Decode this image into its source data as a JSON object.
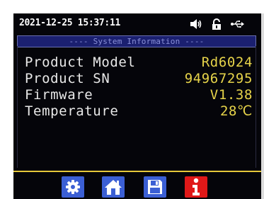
{
  "status_bar": {
    "datetime": "2021-12-25 15:37:11",
    "icons": [
      "speaker-icon",
      "unlock-icon",
      "usb-icon"
    ]
  },
  "section": {
    "title": "---- System Information ----"
  },
  "info_rows": [
    {
      "label": "Product Model",
      "value": "Rd6024"
    },
    {
      "label": "Product SN",
      "value": "94967295"
    },
    {
      "label": "Firmware",
      "value": "V1.38"
    },
    {
      "label": "Temperature",
      "value": "28℃"
    }
  ],
  "toolbar": {
    "buttons": [
      {
        "icon": "gear-icon",
        "color": "#3b5fd4"
      },
      {
        "icon": "home-icon",
        "color": "#3b5fd4"
      },
      {
        "icon": "save-icon",
        "color": "#3b5fd4"
      },
      {
        "icon": "info-icon",
        "color": "#e01818"
      }
    ]
  },
  "colors": {
    "label": "#e8e8e8",
    "value": "#e7d44a",
    "accent_line": "#e6c83a",
    "title_bg": "#1b2070"
  }
}
